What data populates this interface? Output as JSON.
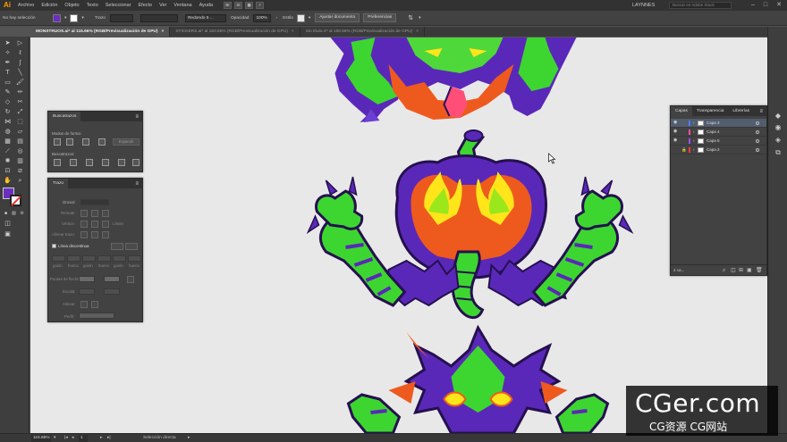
{
  "app": {
    "logo": "Ai"
  },
  "menubar": {
    "items": [
      "Archivo",
      "Edición",
      "Objeto",
      "Texto",
      "Seleccionar",
      "Efecto",
      "Ver",
      "Ventana",
      "Ayuda"
    ],
    "bridge": [
      "Br",
      "St"
    ],
    "user": "LAYNNES",
    "search_placeholder": "Buscar en Adobe Stock",
    "window_controls": [
      "–",
      "□",
      "✕"
    ]
  },
  "controlbar": {
    "selection": "No hay selección",
    "stroke_label": "Trazo",
    "brush": "Redondo 5 ...",
    "opacity_label": "Opacidad",
    "opacity_value": "100%",
    "style_label": "Estilo",
    "doc_setup": "Ajustar documento",
    "preferences": "Preferencias",
    "fill_color": "#6b2ec0"
  },
  "tabs": [
    {
      "label": "MONSTRUOS.ai* al 115.66% (RGB/Previsualización de GPU)",
      "active": true
    },
    {
      "label": "STICKERS.ai* al 150.55% (RGB/Previsualización de GPU)",
      "active": false
    },
    {
      "label": "Sin título-2* al 150.58% (RGB/Previsualización de GPU)",
      "active": false
    }
  ],
  "buscatrazos": {
    "title": "Buscatrazos",
    "modes_label": "Modos de forma:",
    "expand_label": "Expandir",
    "finders_label": "Buscatrazos:"
  },
  "trazo": {
    "title": "Trazo",
    "grosor_label": "Grosor:",
    "remate_label": "Remate:",
    "vertice_label": "Vértice:",
    "limite_label": "Límite:",
    "alinear_label": "Alinear trazo:",
    "dashed_label": "Línea discontinua",
    "dash_labels": [
      "guión",
      "hueco",
      "guión",
      "hueco",
      "guión",
      "hueco"
    ],
    "puntas_label": "Puntas de flecha:",
    "escala_label": "Escala:",
    "alinear2_label": "Alinear:",
    "perfil_label": "Perfil:"
  },
  "layers": {
    "tabs": [
      "Capas",
      "Transparencia",
      "Librerías"
    ],
    "rows": [
      {
        "name": "Capa 3",
        "color": "#4f7cff",
        "visible": true,
        "locked": false,
        "selected": true
      },
      {
        "name": "Capa 4",
        "color": "#ff4fa0",
        "visible": true,
        "locked": false,
        "selected": false
      },
      {
        "name": "Capa 5",
        "color": "#9c4fff",
        "visible": true,
        "locked": false,
        "selected": false
      },
      {
        "name": "Capa 2",
        "color": "#ff3a3a",
        "visible": false,
        "locked": true,
        "selected": false
      }
    ],
    "count": "4 ca..."
  },
  "status": {
    "zoom": "115.66%",
    "page": "1",
    "tool": "Selección directa"
  },
  "watermark": {
    "big": "CGer.com",
    "small": "CG资源 CG网站"
  },
  "icons": {
    "tools": [
      "selection-icon",
      "direct-selection-icon",
      "magic-wand-icon",
      "lasso-icon",
      "pen-icon",
      "curvature-icon",
      "type-icon",
      "line-icon",
      "rectangle-icon",
      "paintbrush-icon",
      "shaper-icon",
      "pencil-icon",
      "eraser-icon",
      "rotate-icon",
      "scale-icon",
      "width-icon",
      "free-transform-icon",
      "shape-builder-icon",
      "perspective-icon",
      "mesh-icon",
      "gradient-icon",
      "eyedropper-icon",
      "blend-icon",
      "symbol-sprayer-icon",
      "column-graph-icon",
      "artboard-icon",
      "slice-icon",
      "hand-icon",
      "zoom-icon"
    ]
  }
}
